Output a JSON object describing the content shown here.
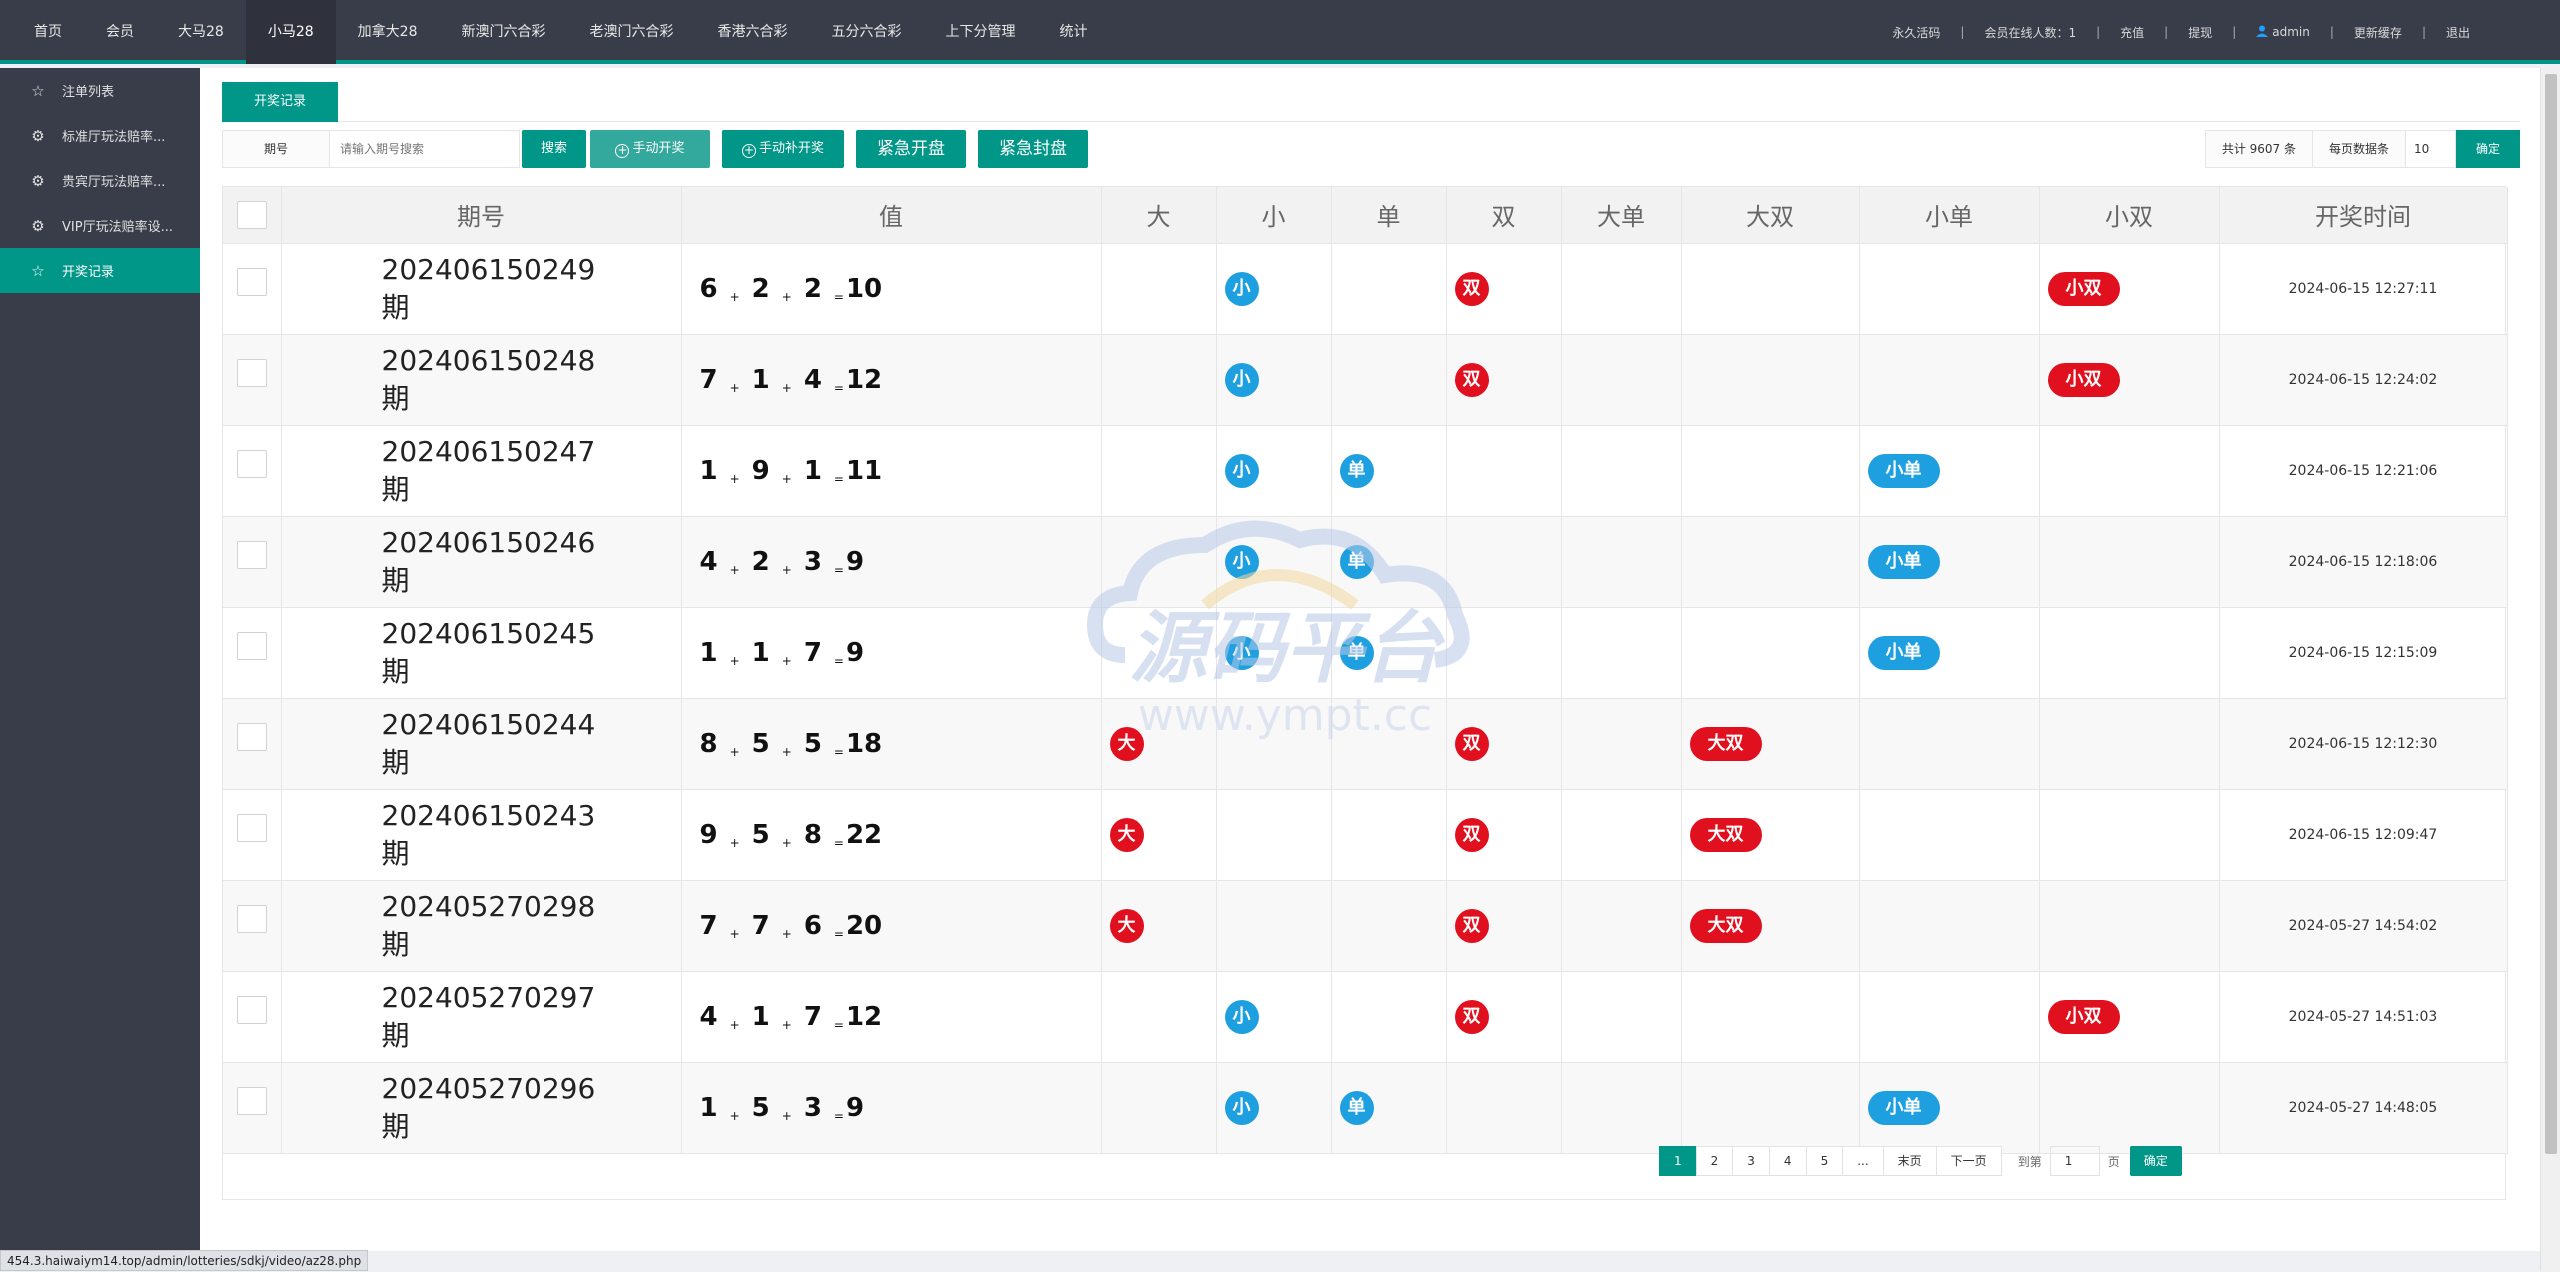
{
  "nav": {
    "items": [
      "首页",
      "会员",
      "大马28",
      "小马28",
      "加拿大28",
      "新澳门六合彩",
      "老澳门六合彩",
      "香港六合彩",
      "五分六合彩",
      "上下分管理",
      "统计"
    ],
    "active": "小马28"
  },
  "topright": {
    "activation": "永久活码",
    "online_label": "会员在线人数：",
    "online_count": "1",
    "recharge": "充值",
    "withdraw": "提现",
    "user": "admin",
    "refresh_cache": "更新缓存",
    "logout": "退出"
  },
  "sidebar": {
    "items": [
      {
        "label": "注单列表",
        "icon": "star-outline-icon"
      },
      {
        "label": "标准厅玩法赔率...",
        "icon": "gear-icon"
      },
      {
        "label": "贵宾厅玩法赔率...",
        "icon": "gear-icon"
      },
      {
        "label": "VIP厅玩法赔率设...",
        "icon": "gear-icon"
      },
      {
        "label": "开奖记录",
        "icon": "star-outline-icon"
      }
    ],
    "active": "开奖记录"
  },
  "tab": {
    "label": "开奖记录"
  },
  "toolbar": {
    "period_label": "期号",
    "search_placeholder": "请输入期号搜索",
    "search_button": "搜索",
    "manual_draw": "手动开奖",
    "manual_supplement": "手动补开奖",
    "emergency_open": "紧急开盘",
    "emergency_close": "紧急封盘",
    "total": "共计 9607 条",
    "per_page_label": "每页数据条",
    "per_page": "10",
    "confirm": "确定"
  },
  "table": {
    "headers": [
      "期号",
      "值",
      "大",
      "小",
      "单",
      "双",
      "大单",
      "大双",
      "小单",
      "小双",
      "开奖时间"
    ],
    "period_suffix": "期",
    "rows": [
      {
        "period": "202406150249",
        "nums": [
          "6",
          "2",
          "2"
        ],
        "sum": "10",
        "da": "",
        "xiao": "小",
        "dan": "",
        "shuang": "双",
        "dadan": "",
        "dashuang": "",
        "xiaodan": "",
        "xiaoshuang": "小双",
        "time": "2024-06-15 12:27:11"
      },
      {
        "period": "202406150248",
        "nums": [
          "7",
          "1",
          "4"
        ],
        "sum": "12",
        "da": "",
        "xiao": "小",
        "dan": "",
        "shuang": "双",
        "dadan": "",
        "dashuang": "",
        "xiaodan": "",
        "xiaoshuang": "小双",
        "time": "2024-06-15 12:24:02"
      },
      {
        "period": "202406150247",
        "nums": [
          "1",
          "9",
          "1"
        ],
        "sum": "11",
        "da": "",
        "xiao": "小",
        "dan": "单",
        "shuang": "",
        "dadan": "",
        "dashuang": "",
        "xiaodan": "小单",
        "xiaoshuang": "",
        "time": "2024-06-15 12:21:06"
      },
      {
        "period": "202406150246",
        "nums": [
          "4",
          "2",
          "3"
        ],
        "sum": "9",
        "da": "",
        "xiao": "小",
        "dan": "单",
        "shuang": "",
        "dadan": "",
        "dashuang": "",
        "xiaodan": "小单",
        "xiaoshuang": "",
        "time": "2024-06-15 12:18:06"
      },
      {
        "period": "202406150245",
        "nums": [
          "1",
          "1",
          "7"
        ],
        "sum": "9",
        "da": "",
        "xiao": "小",
        "dan": "单",
        "shuang": "",
        "dadan": "",
        "dashuang": "",
        "xiaodan": "小单",
        "xiaoshuang": "",
        "time": "2024-06-15 12:15:09"
      },
      {
        "period": "202406150244",
        "nums": [
          "8",
          "5",
          "5"
        ],
        "sum": "18",
        "da": "大",
        "xiao": "",
        "dan": "",
        "shuang": "双",
        "dadan": "",
        "dashuang": "大双",
        "xiaodan": "",
        "xiaoshuang": "",
        "time": "2024-06-15 12:12:30"
      },
      {
        "period": "202406150243",
        "nums": [
          "9",
          "5",
          "8"
        ],
        "sum": "22",
        "da": "大",
        "xiao": "",
        "dan": "",
        "shuang": "双",
        "dadan": "",
        "dashuang": "大双",
        "xiaodan": "",
        "xiaoshuang": "",
        "time": "2024-06-15 12:09:47"
      },
      {
        "period": "202405270298",
        "nums": [
          "7",
          "7",
          "6"
        ],
        "sum": "20",
        "da": "大",
        "xiao": "",
        "dan": "",
        "shuang": "双",
        "dadan": "",
        "dashuang": "大双",
        "xiaodan": "",
        "xiaoshuang": "",
        "time": "2024-05-27 14:54:02"
      },
      {
        "period": "202405270297",
        "nums": [
          "4",
          "1",
          "7"
        ],
        "sum": "12",
        "da": "",
        "xiao": "小",
        "dan": "",
        "shuang": "双",
        "dadan": "",
        "dashuang": "",
        "xiaodan": "",
        "xiaoshuang": "小双",
        "time": "2024-05-27 14:51:03"
      },
      {
        "period": "202405270296",
        "nums": [
          "1",
          "5",
          "3"
        ],
        "sum": "9",
        "da": "",
        "xiao": "小",
        "dan": "单",
        "shuang": "",
        "dadan": "",
        "dashuang": "",
        "xiaodan": "小单",
        "xiaoshuang": "",
        "time": "2024-05-27 14:48:05"
      }
    ]
  },
  "pagination": {
    "pages": [
      "1",
      "2",
      "3",
      "4",
      "5",
      "...",
      "末页",
      "下一页"
    ],
    "current": "1",
    "goto_label": "到第",
    "goto_value": "1",
    "page_unit": "页",
    "confirm": "确定"
  },
  "watermark": {
    "title": "源码平台",
    "url": "www.ympt.cc"
  },
  "statusbar": {
    "url": "454.3.haiwaiym14.top/admin/lotteries/sdkj/video/az28.php"
  },
  "colors": {
    "accent": "#009688",
    "nav_bg": "#393d49",
    "badge_blue": "#1e9fe0",
    "badge_red": "#e0101e"
  }
}
